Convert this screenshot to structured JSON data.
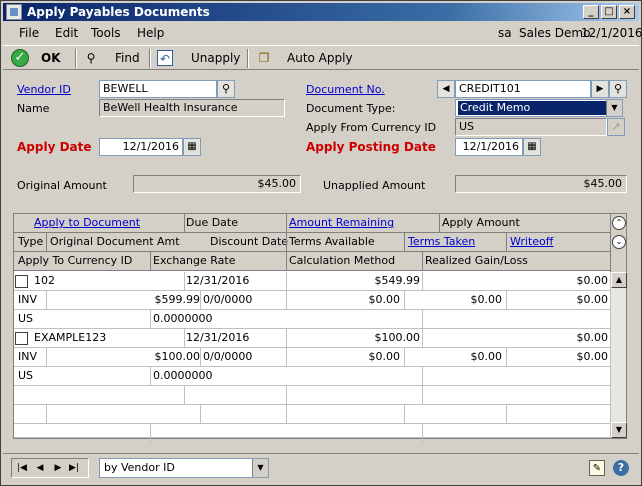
{
  "window": {
    "title": "Apply Payables Documents"
  },
  "menu": {
    "items": [
      "File",
      "Edit",
      "Tools",
      "Help"
    ],
    "user": "sa",
    "company": "Sales Demo",
    "date": "12/1/2016"
  },
  "toolbar": {
    "ok": "OK",
    "find": "Find",
    "unapply": "Unapply",
    "auto_apply": "Auto Apply"
  },
  "form": {
    "vendor_id_label": "Vendor ID",
    "vendor_id": "BEWELL",
    "name_label": "Name",
    "name": "BeWell Health Insurance",
    "apply_date_label": "Apply Date",
    "apply_date": "12/1/2016",
    "document_no_label": "Document No.",
    "document_no": "CREDIT101",
    "document_type_label": "Document Type:",
    "document_type": "Credit Memo",
    "currency_label": "Apply From Currency ID",
    "currency": "US",
    "posting_date_label": "Apply Posting Date",
    "posting_date": "12/1/2016",
    "original_amount_label": "Original Amount",
    "original_amount": "$45.00",
    "unapplied_amount_label": "Unapplied Amount",
    "unapplied_amount": "$45.00"
  },
  "grid": {
    "h1": {
      "apply_to_document": "Apply to Document",
      "due_date": "Due Date",
      "amount_remaining": "Amount Remaining",
      "apply_amount": "Apply Amount"
    },
    "h2": {
      "type": "Type",
      "original_doc_amt": "Original Document Amt",
      "discount_date": "Discount Date",
      "terms_available": "Terms Available",
      "terms_taken": "Terms Taken",
      "writeoff": "Writeoff"
    },
    "h3": {
      "currency": "Apply To Currency ID",
      "exchange_rate": "Exchange Rate",
      "calc_method": "Calculation Method",
      "realized_gain": "Realized Gain/Loss"
    },
    "records": [
      {
        "doc": "102",
        "due": "12/31/2016",
        "remaining": "$549.99",
        "apply": "$0.00",
        "type": "INV",
        "orig": "$599.99",
        "disc_date": "0/0/0000",
        "terms_avail": "$0.00",
        "terms_taken": "$0.00",
        "writeoff": "$0.00",
        "cur": "US",
        "rate": "0.0000000"
      },
      {
        "doc": "EXAMPLE123",
        "due": "12/31/2016",
        "remaining": "$100.00",
        "apply": "$0.00",
        "type": "INV",
        "orig": "$100.00",
        "disc_date": "0/0/0000",
        "terms_avail": "$0.00",
        "terms_taken": "$0.00",
        "writeoff": "$0.00",
        "cur": "US",
        "rate": "0.0000000"
      }
    ]
  },
  "status": {
    "sort": "by Vendor ID"
  }
}
